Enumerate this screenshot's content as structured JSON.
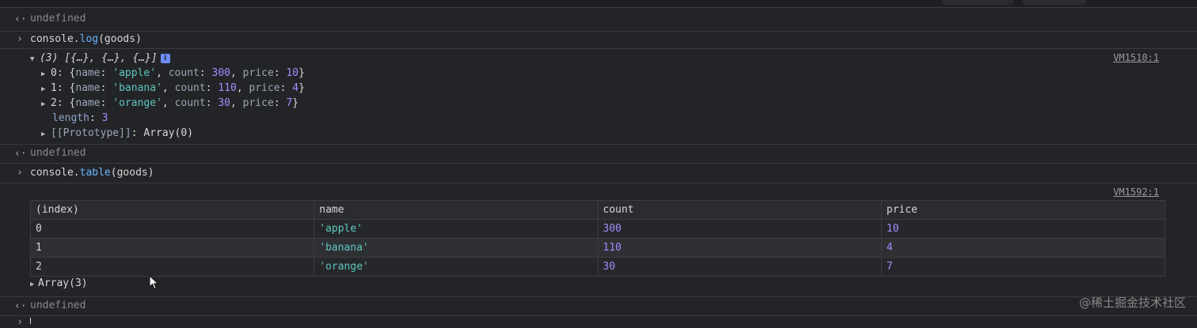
{
  "console": {
    "r1": {
      "text": "undefined"
    },
    "r2": {
      "cmd_prefix": "console.",
      "cmd_fn": "log",
      "cmd_arg": "(goods)"
    },
    "r3": {
      "summary": "(3) [{…}, {…}, {…}]",
      "badge": "i",
      "source": "VM1510:1",
      "items": [
        {
          "idx": "0",
          "name": "'apple'",
          "count": "300",
          "price": "10"
        },
        {
          "idx": "1",
          "name": "'banana'",
          "count": "110",
          "price": "4"
        },
        {
          "idx": "2",
          "name": "'orange'",
          "count": "30",
          "price": "7"
        }
      ],
      "length_key": "length",
      "length_val": "3",
      "proto_key": "[[Prototype]]",
      "proto_val": "Array(0)"
    },
    "r4": {
      "text": "undefined"
    },
    "r5": {
      "cmd_prefix": "console.",
      "cmd_fn": "table",
      "cmd_arg": "(goods)"
    },
    "r6": {
      "source": "VM1592:1",
      "headers": [
        "(index)",
        "name",
        "count",
        "price"
      ],
      "rows": [
        [
          "0",
          "'apple'",
          "300",
          "10"
        ],
        [
          "1",
          "'banana'",
          "110",
          "4"
        ],
        [
          "2",
          "'orange'",
          "30",
          "7"
        ]
      ],
      "array_label": "Array(3)"
    },
    "r7": {
      "text": "undefined"
    }
  },
  "watermark": "@稀土掘金技术社区",
  "icons": {
    "result": "return-arrow-icon",
    "prompt": "prompt-chevron-icon",
    "expand": "expand-triangle-icon"
  }
}
